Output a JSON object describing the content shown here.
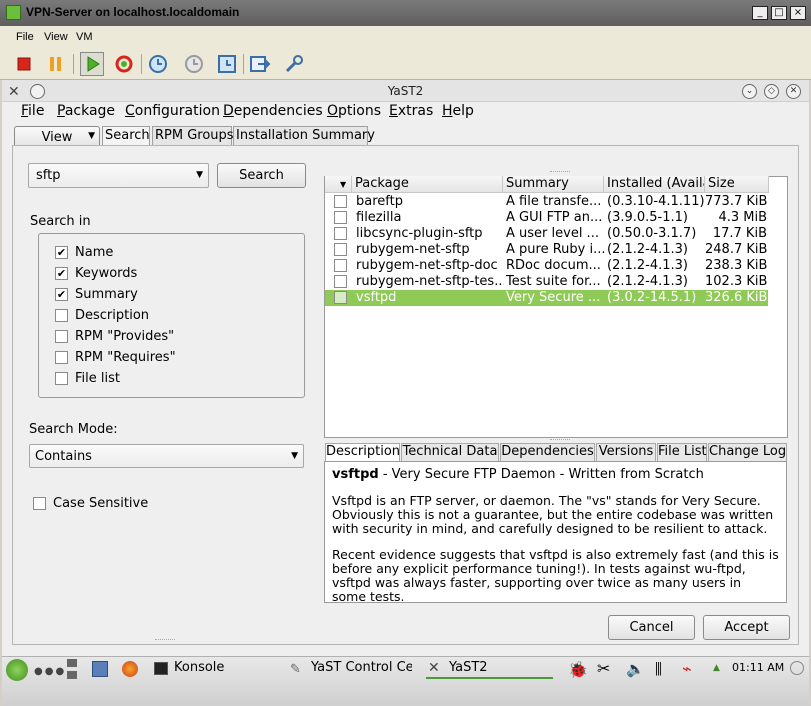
{
  "vm": {
    "title": "VPN-Server on localhost.localdomain",
    "menus": [
      "File",
      "View",
      "VM"
    ],
    "window_buttons": [
      "_",
      "□",
      "×"
    ],
    "toolbar_icons": [
      "stop-icon",
      "pause-icon",
      "play-icon",
      "refresh-icon",
      "snapshot-icon",
      "snapshot-revert-icon",
      "snapshot-manager-icon",
      "send-keys-icon",
      "settings-icon"
    ]
  },
  "yast": {
    "title": "YaST2",
    "menus": [
      {
        "pre": "",
        "u": "F",
        "post": "ile"
      },
      {
        "pre": "",
        "u": "P",
        "post": "ackage"
      },
      {
        "pre": "",
        "u": "C",
        "post": "onfiguration"
      },
      {
        "pre": "",
        "u": "D",
        "post": "ependencies"
      },
      {
        "pre": "",
        "u": "O",
        "post": "ptions"
      },
      {
        "pre": "",
        "u": "E",
        "post": "xtras"
      },
      {
        "pre": "",
        "u": "H",
        "post": "elp"
      }
    ],
    "view_button": "View",
    "tabs": [
      "Search",
      "RPM Groups",
      "Installation Summary"
    ],
    "search": {
      "value": "sftp",
      "button": "Search",
      "search_in_label": "Search in",
      "options": [
        {
          "label": "Name",
          "checked": true
        },
        {
          "label": "Keywords",
          "checked": true
        },
        {
          "label": "Summary",
          "checked": true
        },
        {
          "label": "Description",
          "checked": false
        },
        {
          "label": "RPM \"Provides\"",
          "checked": false
        },
        {
          "label": "RPM \"Requires\"",
          "checked": false
        },
        {
          "label": "File list",
          "checked": false
        }
      ],
      "mode_label": "Search Mode:",
      "mode_value": "Contains",
      "case_sensitive": "Case Sensitive"
    },
    "table": {
      "headers": [
        "Package",
        "Summary",
        "Installed (Available)",
        "Size"
      ],
      "header_display": [
        "Package",
        "Summary",
        "Installed (Availa",
        "Size"
      ],
      "rows": [
        {
          "name": "bareftp",
          "summary": "A file transfe...",
          "installed": "(0.3.10-4.1.11)",
          "size": "773.7 KiB",
          "selected": false
        },
        {
          "name": "filezilla",
          "summary": "A GUI FTP an...",
          "installed": "(3.9.0.5-1.1)",
          "size": "4.3 MiB",
          "selected": false
        },
        {
          "name": "libcsync-plugin-sftp",
          "summary": "A user level ...",
          "installed": "(0.50.0-3.1.7)",
          "size": "17.7 KiB",
          "selected": false
        },
        {
          "name": "rubygem-net-sftp",
          "summary": "A pure Ruby i...",
          "installed": "(2.1.2-4.1.3)",
          "size": "248.7 KiB",
          "selected": false
        },
        {
          "name": "rubygem-net-sftp-doc",
          "summary": "RDoc docum...",
          "installed": "(2.1.2-4.1.3)",
          "size": "238.3 KiB",
          "selected": false
        },
        {
          "name": "rubygem-net-sftp-tes...",
          "summary": "Test suite for...",
          "installed": "(2.1.2-4.1.3)",
          "size": "102.3 KiB",
          "selected": false
        },
        {
          "name": "vsftpd",
          "summary": "Very Secure ...",
          "installed": "(3.0.2-14.5.1)",
          "size": "326.6 KiB",
          "selected": true
        }
      ]
    },
    "detail_tabs": [
      "Description",
      "Technical Data",
      "Dependencies",
      "Versions",
      "File List",
      "Change Log"
    ],
    "description": {
      "pkg_name": "vsftpd",
      "pkg_summary": " - Very Secure FTP Daemon - Written from Scratch",
      "para1": "Vsftpd is an FTP server, or daemon. The \"vs\" stands for Very Secure. Obviously this is not a guarantee, but the entire codebase was written with security in mind, and carefully designed to be resilient to attack.",
      "para2": "Recent evidence suggests that vsftpd is also extremely fast (and this is before any explicit performance tuning!). In tests against wu-ftpd, vsftpd was always faster, supporting over twice as many users in some tests."
    },
    "cancel": "Cancel",
    "accept": "Accept"
  },
  "taskbar": {
    "konsole": "Konsole",
    "yast_control": "YaST Control Cer",
    "yast2": "YaST2",
    "clock": "01:11 AM"
  },
  "colors": {
    "selection": "#8fca56",
    "vm_titlebar": "#6b6b6b"
  }
}
